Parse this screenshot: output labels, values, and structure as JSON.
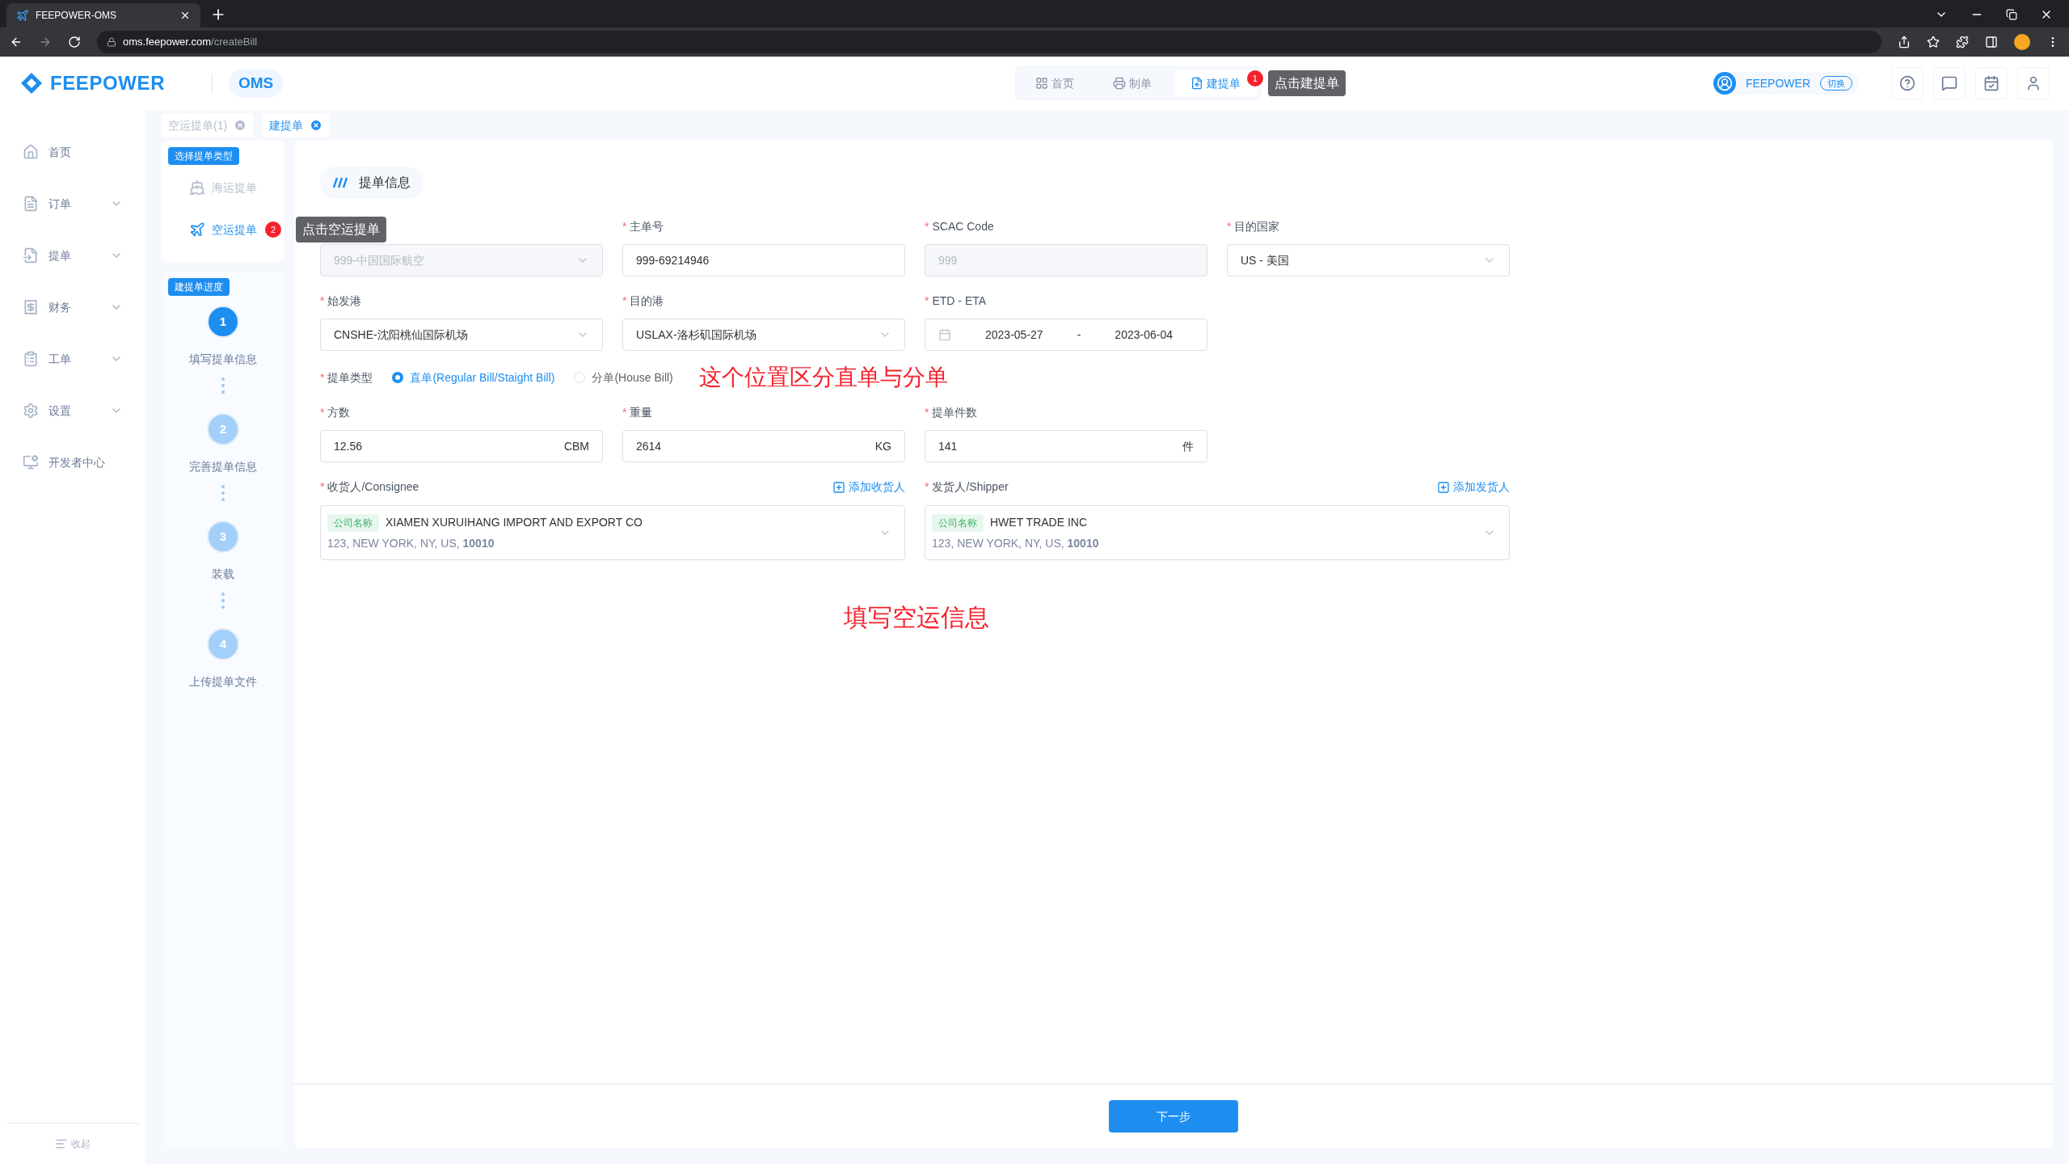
{
  "browser": {
    "tab_title": "FEEPOWER-OMS",
    "url_host": "oms.feepower.com",
    "url_path": "/createBill"
  },
  "header": {
    "logo": "FEEPOWER",
    "app": "OMS",
    "nav": [
      {
        "label": "首页",
        "selected": false
      },
      {
        "label": "制单",
        "selected": false
      },
      {
        "label": "建提单",
        "selected": true
      }
    ],
    "nav_badge": "1",
    "nav_tooltip": "点击建提单",
    "user": "FEEPOWER",
    "switch": "切换"
  },
  "sidebar": {
    "items": [
      {
        "label": "首页",
        "expandable": false
      },
      {
        "label": "订单",
        "expandable": true
      },
      {
        "label": "提单",
        "expandable": true
      },
      {
        "label": "财务",
        "expandable": true
      },
      {
        "label": "工单",
        "expandable": true
      },
      {
        "label": "设置",
        "expandable": true
      },
      {
        "label": "开发者中心",
        "expandable": false
      }
    ],
    "collapse": "收起"
  },
  "page_tabs": [
    {
      "label": "空运提单(1)",
      "selected": false
    },
    {
      "label": "建提单",
      "selected": true
    }
  ],
  "bill_type": {
    "title": "选择提单类型",
    "options": [
      {
        "label": "海运提单",
        "selected": false
      },
      {
        "label": "空运提单",
        "selected": true
      }
    ],
    "badge": "2",
    "tooltip": "点击空运提单"
  },
  "progress": {
    "title": "建提单进度",
    "steps": [
      {
        "number": "1",
        "label": "填写提单信息",
        "active": true
      },
      {
        "number": "2",
        "label": "完善提单信息",
        "active": false
      },
      {
        "number": "3",
        "label": "装载",
        "active": false
      },
      {
        "number": "4",
        "label": "上传提单文件",
        "active": false
      }
    ]
  },
  "section_title": "提单信息",
  "fields": [
    {
      "kind": "select",
      "value": "999-中国国际航空",
      "disabled": true
    },
    {
      "kind": "input",
      "required_mark": "*",
      "label": "主单号",
      "value": "999-69214946",
      "disabled": false
    },
    {
      "kind": "input",
      "required_mark": "*",
      "label": "SCAC Code",
      "value": "999",
      "disabled": true
    },
    {
      "kind": "select",
      "required_mark": "*",
      "label": "目的国家",
      "value": "US - 美国",
      "disabled": false
    },
    {
      "kind": "select",
      "required_mark": "*",
      "label": "始发港",
      "value": "CNSHE-沈阳桃仙国际机场",
      "disabled": false
    },
    {
      "kind": "select",
      "required_mark": "*",
      "label": "目的港",
      "value": "USLAX-洛杉矶国际机场",
      "disabled": false
    },
    {
      "kind": "date",
      "required_mark": "*",
      "label": "ETD - ETA",
      "start": "2023-05-27",
      "separator": "-",
      "end": "2023-06-04"
    }
  ],
  "bill_kind": {
    "required_mark": "*",
    "label": "提单类型",
    "options": [
      {
        "label": "直单(Regular Bill/Staight Bill)",
        "selected": true
      },
      {
        "label": "分单(House Bill)",
        "selected": false
      }
    ],
    "note": "这个位置区分直单与分单"
  },
  "measures": [
    {
      "required_mark": "*",
      "label": "方数",
      "value": "12.56",
      "unit": "CBM"
    },
    {
      "required_mark": "*",
      "label": "重量",
      "value": "2614",
      "unit": "KG"
    },
    {
      "required_mark": "*",
      "label": "提单件数",
      "value": "141",
      "unit": "件"
    }
  ],
  "parties": [
    {
      "required_mark": "*",
      "label": "收货人/Consignee",
      "add": "添加收货人",
      "tag": "公司名称",
      "name": "XIAMEN XURUIHANG IMPORT AND EXPORT CO",
      "address": "123, NEW YORK, NY, US, **10010**"
    },
    {
      "required_mark": "*",
      "label": "发货人/Shipper",
      "add": "添加发货人",
      "tag": "公司名称",
      "name": "HWET TRADE INC",
      "address": "123, NEW YORK, NY, US, **10010**"
    }
  ],
  "note": "填写空运信息",
  "next_button": "下一步"
}
